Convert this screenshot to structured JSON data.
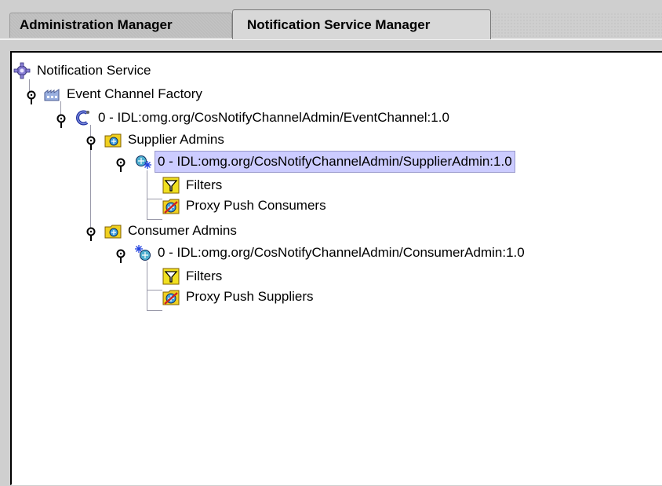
{
  "tabs": [
    {
      "label": "Administration Manager",
      "active": false
    },
    {
      "label": "Notification Service Manager",
      "active": true
    }
  ],
  "tree": {
    "root": {
      "label": "Notification Service",
      "icon": "notification-service-icon"
    },
    "factory": {
      "label": "Event Channel Factory",
      "icon": "factory-icon"
    },
    "channel": {
      "label": "0 - IDL:omg.org/CosNotifyChannelAdmin/EventChannel:1.0",
      "icon": "event-channel-icon"
    },
    "supplier_admins": {
      "label": "Supplier Admins",
      "icon": "folder-icon"
    },
    "supplier_admin": {
      "label": "0 - IDL:omg.org/CosNotifyChannelAdmin/SupplierAdmin:1.0",
      "icon": "supplier-admin-icon",
      "selected": true
    },
    "supplier_filters": {
      "label": "Filters",
      "icon": "filter-icon"
    },
    "proxy_push_consumers": {
      "label": "Proxy Push Consumers",
      "icon": "proxy-icon"
    },
    "consumer_admins": {
      "label": "Consumer Admins",
      "icon": "folder-icon"
    },
    "consumer_admin": {
      "label": "0 - IDL:omg.org/CosNotifyChannelAdmin/ConsumerAdmin:1.0",
      "icon": "consumer-admin-icon"
    },
    "consumer_filters": {
      "label": "Filters",
      "icon": "filter-icon"
    },
    "proxy_push_suppliers": {
      "label": "Proxy Push Suppliers",
      "icon": "proxy-icon"
    }
  },
  "colors": {
    "selection": "#ccccff",
    "folder": "#f0d020",
    "tree_line": "#9a9aaa"
  }
}
